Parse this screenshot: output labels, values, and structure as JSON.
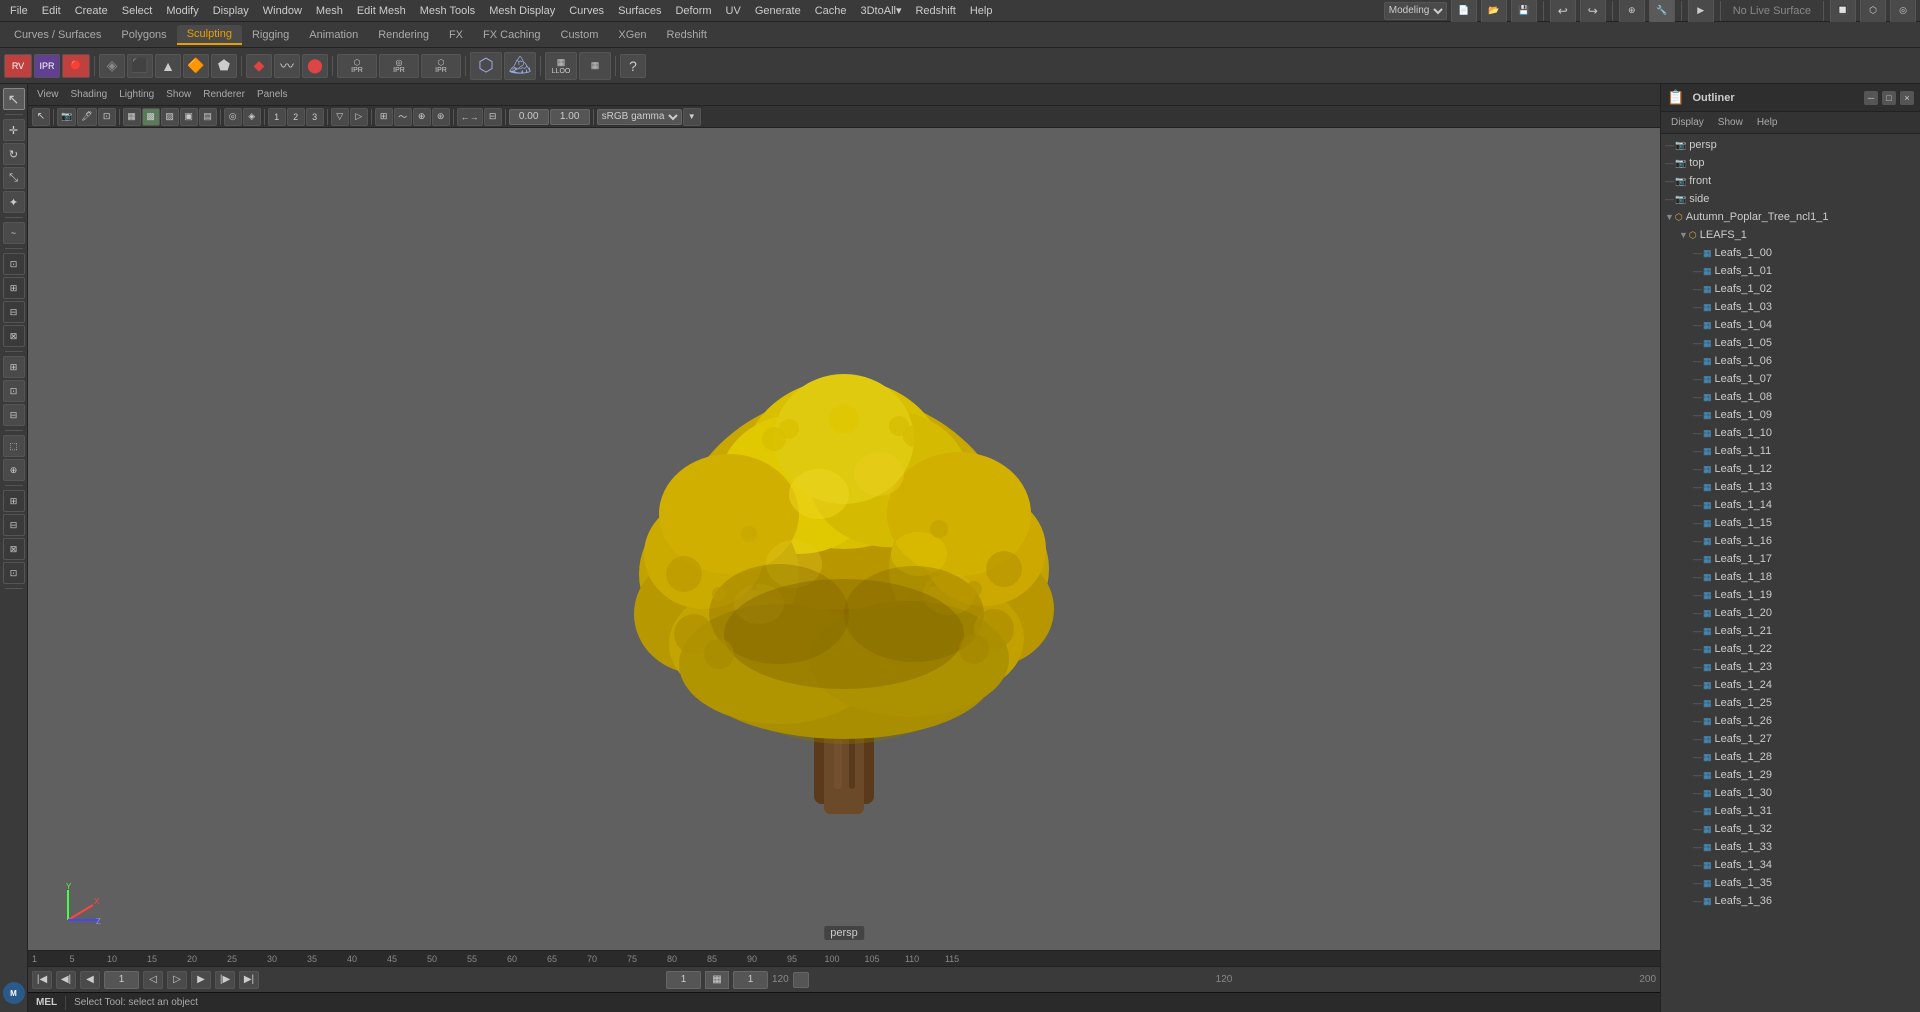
{
  "app": {
    "title": "Autodesk Maya"
  },
  "menu_bar": {
    "items": [
      "File",
      "Edit",
      "Create",
      "Select",
      "Modify",
      "Display",
      "Window",
      "Mesh",
      "Edit Mesh",
      "Mesh Tools",
      "Mesh Display",
      "Curves",
      "Surfaces",
      "Deform",
      "UV",
      "Generate",
      "Cache",
      "3DtoAll",
      "Redshift",
      "Help"
    ]
  },
  "mode_selector": {
    "current": "Modeling"
  },
  "no_live_surface": "No Live Surface",
  "shelf_tabs": {
    "items": [
      "Curves / Surfaces",
      "Polygons",
      "Sculpting",
      "Rigging",
      "Animation",
      "Rendering",
      "FX",
      "FX Caching",
      "Custom",
      "XGen",
      "Redshift"
    ]
  },
  "viewport_menus": {
    "items": [
      "View",
      "Shading",
      "Lighting",
      "Show",
      "Renderer",
      "Panels"
    ]
  },
  "viewport_label": "persp",
  "outliner": {
    "title": "Outliner",
    "menu_items": [
      "Display",
      "Show",
      "Help"
    ],
    "items": [
      {
        "label": "persp",
        "level": 0,
        "icon": "camera",
        "has_arrow": false
      },
      {
        "label": "top",
        "level": 0,
        "icon": "camera",
        "has_arrow": false
      },
      {
        "label": "front",
        "level": 0,
        "icon": "camera",
        "has_arrow": false
      },
      {
        "label": "side",
        "level": 0,
        "icon": "camera",
        "has_arrow": false
      },
      {
        "label": "Autumn_Poplar_Tree_ncl1_1",
        "level": 0,
        "icon": "transform",
        "has_arrow": true
      },
      {
        "label": "LEAFS_1",
        "level": 1,
        "icon": "transform",
        "has_arrow": true
      },
      {
        "label": "Leafs_1_00",
        "level": 2,
        "icon": "mesh",
        "has_arrow": false
      },
      {
        "label": "Leafs_1_01",
        "level": 2,
        "icon": "mesh",
        "has_arrow": false
      },
      {
        "label": "Leafs_1_02",
        "level": 2,
        "icon": "mesh",
        "has_arrow": false
      },
      {
        "label": "Leafs_1_03",
        "level": 2,
        "icon": "mesh",
        "has_arrow": false
      },
      {
        "label": "Leafs_1_04",
        "level": 2,
        "icon": "mesh",
        "has_arrow": false
      },
      {
        "label": "Leafs_1_05",
        "level": 2,
        "icon": "mesh",
        "has_arrow": false
      },
      {
        "label": "Leafs_1_06",
        "level": 2,
        "icon": "mesh",
        "has_arrow": false
      },
      {
        "label": "Leafs_1_07",
        "level": 2,
        "icon": "mesh",
        "has_arrow": false
      },
      {
        "label": "Leafs_1_08",
        "level": 2,
        "icon": "mesh",
        "has_arrow": false
      },
      {
        "label": "Leafs_1_09",
        "level": 2,
        "icon": "mesh",
        "has_arrow": false
      },
      {
        "label": "Leafs_1_10",
        "level": 2,
        "icon": "mesh",
        "has_arrow": false
      },
      {
        "label": "Leafs_1_11",
        "level": 2,
        "icon": "mesh",
        "has_arrow": false
      },
      {
        "label": "Leafs_1_12",
        "level": 2,
        "icon": "mesh",
        "has_arrow": false
      },
      {
        "label": "Leafs_1_13",
        "level": 2,
        "icon": "mesh",
        "has_arrow": false
      },
      {
        "label": "Leafs_1_14",
        "level": 2,
        "icon": "mesh",
        "has_arrow": false
      },
      {
        "label": "Leafs_1_15",
        "level": 2,
        "icon": "mesh",
        "has_arrow": false
      },
      {
        "label": "Leafs_1_16",
        "level": 2,
        "icon": "mesh",
        "has_arrow": false
      },
      {
        "label": "Leafs_1_17",
        "level": 2,
        "icon": "mesh",
        "has_arrow": false
      },
      {
        "label": "Leafs_1_18",
        "level": 2,
        "icon": "mesh",
        "has_arrow": false
      },
      {
        "label": "Leafs_1_19",
        "level": 2,
        "icon": "mesh",
        "has_arrow": false
      },
      {
        "label": "Leafs_1_20",
        "level": 2,
        "icon": "mesh",
        "has_arrow": false
      },
      {
        "label": "Leafs_1_21",
        "level": 2,
        "icon": "mesh",
        "has_arrow": false
      },
      {
        "label": "Leafs_1_22",
        "level": 2,
        "icon": "mesh",
        "has_arrow": false
      },
      {
        "label": "Leafs_1_23",
        "level": 2,
        "icon": "mesh",
        "has_arrow": false
      },
      {
        "label": "Leafs_1_24",
        "level": 2,
        "icon": "mesh",
        "has_arrow": false
      },
      {
        "label": "Leafs_1_25",
        "level": 2,
        "icon": "mesh",
        "has_arrow": false
      },
      {
        "label": "Leafs_1_26",
        "level": 2,
        "icon": "mesh",
        "has_arrow": false
      },
      {
        "label": "Leafs_1_27",
        "level": 2,
        "icon": "mesh",
        "has_arrow": false
      },
      {
        "label": "Leafs_1_28",
        "level": 2,
        "icon": "mesh",
        "has_arrow": false
      },
      {
        "label": "Leafs_1_29",
        "level": 2,
        "icon": "mesh",
        "has_arrow": false
      },
      {
        "label": "Leafs_1_30",
        "level": 2,
        "icon": "mesh",
        "has_arrow": false
      },
      {
        "label": "Leafs_1_31",
        "level": 2,
        "icon": "mesh",
        "has_arrow": false
      },
      {
        "label": "Leafs_1_32",
        "level": 2,
        "icon": "mesh",
        "has_arrow": false
      },
      {
        "label": "Leafs_1_33",
        "level": 2,
        "icon": "mesh",
        "has_arrow": false
      },
      {
        "label": "Leafs_1_34",
        "level": 2,
        "icon": "mesh",
        "has_arrow": false
      },
      {
        "label": "Leafs_1_35",
        "level": 2,
        "icon": "mesh",
        "has_arrow": false
      },
      {
        "label": "Leafs_1_36",
        "level": 2,
        "icon": "mesh",
        "has_arrow": false
      }
    ]
  },
  "timeline": {
    "marks": [
      "5",
      "10",
      "15",
      "20",
      "25",
      "30",
      "35",
      "40",
      "45",
      "50",
      "55",
      "60",
      "65",
      "70",
      "75",
      "80",
      "85",
      "90",
      "95",
      "100",
      "105",
      "110",
      "115"
    ],
    "current_frame": "1",
    "start_frame": "1",
    "end_frame": "120",
    "range_start": "120",
    "range_end": "200"
  },
  "playback": {
    "current_frame": "1",
    "start": "1",
    "end": "120",
    "range_end": "200"
  },
  "status_bar": {
    "mel_label": "MEL",
    "status_text": "Select Tool: select an object"
  },
  "viewport_tools": {
    "value1": "0.00",
    "value2": "1.00",
    "color_profile": "sRGB gamma"
  }
}
